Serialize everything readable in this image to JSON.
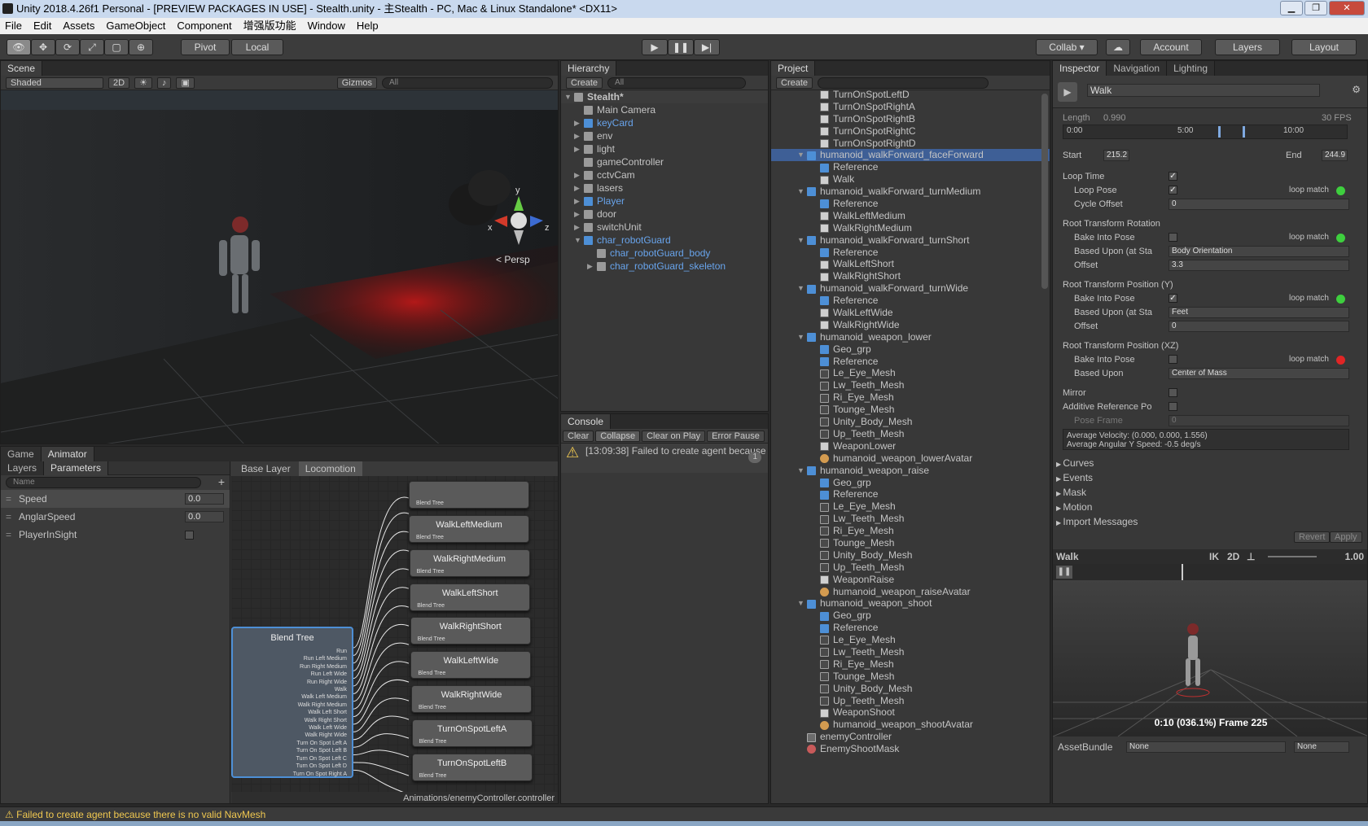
{
  "window": {
    "title": "Unity 2018.4.26f1 Personal - [PREVIEW PACKAGES IN USE] - Stealth.unity - 主Stealth - PC, Mac & Linux Standalone* <DX11>"
  },
  "menu": [
    "File",
    "Edit",
    "Assets",
    "GameObject",
    "Component",
    "增强版功能",
    "Window",
    "Help"
  ],
  "toolbar": {
    "pivot": "Pivot",
    "local": "Local",
    "collab": "Collab ▾",
    "account": "Account",
    "layers": "Layers",
    "layout": "Layout"
  },
  "scene": {
    "tab": "Scene",
    "shading": "Shaded",
    "mode2d": "2D",
    "gizmos": "Gizmos",
    "search": "All",
    "persp": "< Persp",
    "axis_y": "y",
    "axis_z": "z",
    "axis_x": "x"
  },
  "hierarchy": {
    "tab": "Hierarchy",
    "create": "Create",
    "search": "All",
    "root": "Stealth*",
    "items": [
      {
        "label": "Main Camera",
        "icon": "cube",
        "blue": false,
        "indent": 0,
        "arrow": ""
      },
      {
        "label": "keyCard",
        "icon": "blue",
        "blue": true,
        "indent": 0,
        "arrow": "▶"
      },
      {
        "label": "env",
        "icon": "cube",
        "blue": false,
        "indent": 0,
        "arrow": "▶"
      },
      {
        "label": "light",
        "icon": "cube",
        "blue": false,
        "indent": 0,
        "arrow": "▶"
      },
      {
        "label": "gameController",
        "icon": "cube",
        "blue": false,
        "indent": 0,
        "arrow": ""
      },
      {
        "label": "cctvCam",
        "icon": "cube",
        "blue": false,
        "indent": 0,
        "arrow": "▶"
      },
      {
        "label": "lasers",
        "icon": "cube",
        "blue": false,
        "indent": 0,
        "arrow": "▶"
      },
      {
        "label": "Player",
        "icon": "blue",
        "blue": true,
        "indent": 0,
        "arrow": "▶"
      },
      {
        "label": "door",
        "icon": "cube",
        "blue": false,
        "indent": 0,
        "arrow": "▶"
      },
      {
        "label": "switchUnit",
        "icon": "cube",
        "blue": false,
        "indent": 0,
        "arrow": "▶"
      },
      {
        "label": "char_robotGuard",
        "icon": "blue",
        "blue": true,
        "indent": 0,
        "arrow": "▼"
      },
      {
        "label": "char_robotGuard_body",
        "icon": "cube",
        "blue": true,
        "indent": 1,
        "arrow": ""
      },
      {
        "label": "char_robotGuard_skeleton",
        "icon": "cube",
        "blue": true,
        "indent": 1,
        "arrow": "▶"
      }
    ]
  },
  "project": {
    "tab": "Project",
    "create": "Create",
    "items": [
      {
        "label": "TurnOnSpotLeftD",
        "icon": "anim",
        "indent": 1,
        "arrow": ""
      },
      {
        "label": "TurnOnSpotRightA",
        "icon": "anim",
        "indent": 1,
        "arrow": ""
      },
      {
        "label": "TurnOnSpotRightB",
        "icon": "anim",
        "indent": 1,
        "arrow": ""
      },
      {
        "label": "TurnOnSpotRightC",
        "icon": "anim",
        "indent": 1,
        "arrow": ""
      },
      {
        "label": "TurnOnSpotRightD",
        "icon": "anim",
        "indent": 1,
        "arrow": ""
      },
      {
        "label": "humanoid_walkForward_faceForward",
        "icon": "blue",
        "indent": 0,
        "arrow": "▼",
        "sel": true
      },
      {
        "label": "Reference",
        "icon": "blue",
        "indent": 1,
        "arrow": ""
      },
      {
        "label": "Walk",
        "icon": "anim",
        "indent": 1,
        "arrow": ""
      },
      {
        "label": "humanoid_walkForward_turnMedium",
        "icon": "blue",
        "indent": 0,
        "arrow": "▼"
      },
      {
        "label": "Reference",
        "icon": "blue",
        "indent": 1,
        "arrow": ""
      },
      {
        "label": "WalkLeftMedium",
        "icon": "anim",
        "indent": 1,
        "arrow": ""
      },
      {
        "label": "WalkRightMedium",
        "icon": "anim",
        "indent": 1,
        "arrow": ""
      },
      {
        "label": "humanoid_walkForward_turnShort",
        "icon": "blue",
        "indent": 0,
        "arrow": "▼"
      },
      {
        "label": "Reference",
        "icon": "blue",
        "indent": 1,
        "arrow": ""
      },
      {
        "label": "WalkLeftShort",
        "icon": "anim",
        "indent": 1,
        "arrow": ""
      },
      {
        "label": "WalkRightShort",
        "icon": "anim",
        "indent": 1,
        "arrow": ""
      },
      {
        "label": "humanoid_walkForward_turnWide",
        "icon": "blue",
        "indent": 0,
        "arrow": "▼"
      },
      {
        "label": "Reference",
        "icon": "blue",
        "indent": 1,
        "arrow": ""
      },
      {
        "label": "WalkLeftWide",
        "icon": "anim",
        "indent": 1,
        "arrow": ""
      },
      {
        "label": "WalkRightWide",
        "icon": "anim",
        "indent": 1,
        "arrow": ""
      },
      {
        "label": "humanoid_weapon_lower",
        "icon": "blue",
        "indent": 0,
        "arrow": "▼"
      },
      {
        "label": "Geo_grp",
        "icon": "blue",
        "indent": 1,
        "arrow": ""
      },
      {
        "label": "Reference",
        "icon": "blue",
        "indent": 1,
        "arrow": ""
      },
      {
        "label": "Le_Eye_Mesh",
        "icon": "mesh",
        "indent": 1,
        "arrow": ""
      },
      {
        "label": "Lw_Teeth_Mesh",
        "icon": "mesh",
        "indent": 1,
        "arrow": ""
      },
      {
        "label": "Ri_Eye_Mesh",
        "icon": "mesh",
        "indent": 1,
        "arrow": ""
      },
      {
        "label": "Tounge_Mesh",
        "icon": "mesh",
        "indent": 1,
        "arrow": ""
      },
      {
        "label": "Unity_Body_Mesh",
        "icon": "mesh",
        "indent": 1,
        "arrow": ""
      },
      {
        "label": "Up_Teeth_Mesh",
        "icon": "mesh",
        "indent": 1,
        "arrow": ""
      },
      {
        "label": "WeaponLower",
        "icon": "anim",
        "indent": 1,
        "arrow": ""
      },
      {
        "label": "humanoid_weapon_lowerAvatar",
        "icon": "avatar",
        "indent": 1,
        "arrow": ""
      },
      {
        "label": "humanoid_weapon_raise",
        "icon": "blue",
        "indent": 0,
        "arrow": "▼"
      },
      {
        "label": "Geo_grp",
        "icon": "blue",
        "indent": 1,
        "arrow": ""
      },
      {
        "label": "Reference",
        "icon": "blue",
        "indent": 1,
        "arrow": ""
      },
      {
        "label": "Le_Eye_Mesh",
        "icon": "mesh",
        "indent": 1,
        "arrow": ""
      },
      {
        "label": "Lw_Teeth_Mesh",
        "icon": "mesh",
        "indent": 1,
        "arrow": ""
      },
      {
        "label": "Ri_Eye_Mesh",
        "icon": "mesh",
        "indent": 1,
        "arrow": ""
      },
      {
        "label": "Tounge_Mesh",
        "icon": "mesh",
        "indent": 1,
        "arrow": ""
      },
      {
        "label": "Unity_Body_Mesh",
        "icon": "mesh",
        "indent": 1,
        "arrow": ""
      },
      {
        "label": "Up_Teeth_Mesh",
        "icon": "mesh",
        "indent": 1,
        "arrow": ""
      },
      {
        "label": "WeaponRaise",
        "icon": "anim",
        "indent": 1,
        "arrow": ""
      },
      {
        "label": "humanoid_weapon_raiseAvatar",
        "icon": "avatar",
        "indent": 1,
        "arrow": ""
      },
      {
        "label": "humanoid_weapon_shoot",
        "icon": "blue",
        "indent": 0,
        "arrow": "▼"
      },
      {
        "label": "Geo_grp",
        "icon": "blue",
        "indent": 1,
        "arrow": ""
      },
      {
        "label": "Reference",
        "icon": "blue",
        "indent": 1,
        "arrow": ""
      },
      {
        "label": "Le_Eye_Mesh",
        "icon": "mesh",
        "indent": 1,
        "arrow": ""
      },
      {
        "label": "Lw_Teeth_Mesh",
        "icon": "mesh",
        "indent": 1,
        "arrow": ""
      },
      {
        "label": "Ri_Eye_Mesh",
        "icon": "mesh",
        "indent": 1,
        "arrow": ""
      },
      {
        "label": "Tounge_Mesh",
        "icon": "mesh",
        "indent": 1,
        "arrow": ""
      },
      {
        "label": "Unity_Body_Mesh",
        "icon": "mesh",
        "indent": 1,
        "arrow": ""
      },
      {
        "label": "Up_Teeth_Mesh",
        "icon": "mesh",
        "indent": 1,
        "arrow": ""
      },
      {
        "label": "WeaponShoot",
        "icon": "anim",
        "indent": 1,
        "arrow": ""
      },
      {
        "label": "humanoid_weapon_shootAvatar",
        "icon": "avatar",
        "indent": 1,
        "arrow": ""
      },
      {
        "label": "enemyController",
        "icon": "ctrl",
        "indent": -1,
        "arrow": ""
      },
      {
        "label": "EnemyShootMask",
        "icon": "mask",
        "indent": -1,
        "arrow": ""
      }
    ]
  },
  "console": {
    "tab": "Console",
    "buttons": [
      "Clear",
      "Collapse",
      "Clear on Play",
      "Error Pause"
    ],
    "message": "[13:09:38] Failed to create agent because",
    "count": "1"
  },
  "animator": {
    "tabs": [
      "Game",
      "Animator"
    ],
    "subtabs": [
      "Layers",
      "Parameters"
    ],
    "search": "Name",
    "breadcrumb": [
      "Base Layer",
      "Locomotion"
    ],
    "params": [
      {
        "name": "Speed",
        "value": "0.0"
      },
      {
        "name": "AnglarSpeed",
        "value": "0.0"
      },
      {
        "name": "PlayerInSight",
        "value": ""
      }
    ],
    "blend_title": "Blend Tree",
    "blend_inputs": [
      "Run",
      "Run Left Medium",
      "Run Right Medium",
      "Run Left Wide",
      "Run Right Wide",
      "Walk",
      "Walk Left Medium",
      "Walk Right Medium",
      "Walk Left Short",
      "Walk Right Short",
      "Walk Left Wide",
      "Walk Right Wide",
      "Turn On Spot Left A",
      "Turn On Spot Left B",
      "Turn On Spot Left C",
      "Turn On Spot Left D",
      "Turn On Spot Right A"
    ],
    "nodes": [
      "WalkLeftMedium",
      "WalkRightMedium",
      "WalkLeftShort",
      "WalkRightShort",
      "WalkLeftWide",
      "WalkRightWide",
      "TurnOnSpotLeftA",
      "TurnOnSpotLeftB"
    ],
    "node_sub": "Blend Tree",
    "path": "Animations/enemyController.controller"
  },
  "inspector": {
    "tabs": [
      "Inspector",
      "Navigation",
      "Lighting"
    ],
    "clip_name": "Walk",
    "length_label": "Length",
    "length": "0.990",
    "fps": "30 FPS",
    "ticks": [
      "0:00",
      "5:00",
      "10:00"
    ],
    "start_label": "Start",
    "start": "215.2",
    "end_label": "End",
    "end": "244.9",
    "loop_time": "Loop Time",
    "loop_pose": "Loop Pose",
    "loop_match": "loop match",
    "cycle_offset": "Cycle Offset",
    "cycle_value": "0",
    "rot_header": "Root Transform Rotation",
    "bake": "Bake Into Pose",
    "based_upon_sta": "Based Upon (at Sta",
    "rot_based": "Body Orientation",
    "offset": "Offset",
    "rot_offset": "3.3",
    "posy_header": "Root Transform Position (Y)",
    "posy_based": "Feet",
    "posy_offset": "0",
    "posxz_header": "Root Transform Position (XZ)",
    "based_upon": "Based Upon",
    "posxz_based": "Center of Mass",
    "mirror": "Mirror",
    "additive": "Additive Reference Po",
    "pose_frame": "Pose Frame",
    "pose_value": "0",
    "velocity": "Average Velocity: (0.000, 0.000, 1.556)",
    "angular": "Average Angular Y Speed: -0.5 deg/s",
    "foldouts": [
      "Curves",
      "Events",
      "Mask",
      "Motion",
      "Import Messages"
    ],
    "revert": "Revert",
    "apply": "Apply",
    "preview_name": "Walk",
    "ik": "IK",
    "mode2d": "2D",
    "speed": "1.00",
    "frame": "0:10 (036.1%) Frame 225",
    "assetbundle": "AssetBundle",
    "none1": "None",
    "none2": "None",
    "match_colors": [
      "#3ecf3e",
      "#3ecf3e",
      "#3ecf3e",
      "#e02525"
    ]
  },
  "status": {
    "message": "Failed to create agent because there is no valid NavMesh"
  }
}
